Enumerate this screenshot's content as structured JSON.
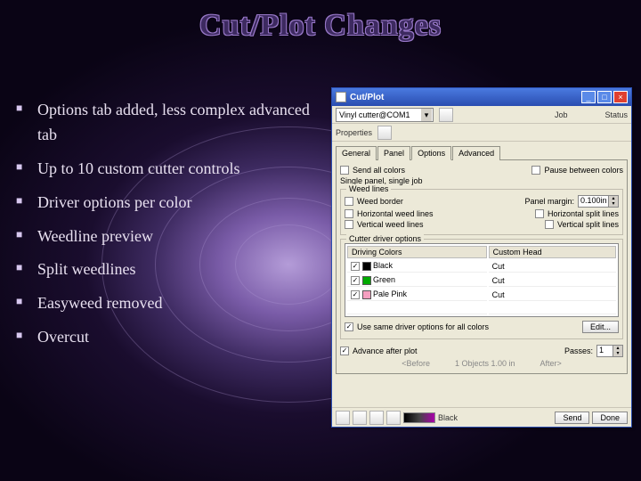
{
  "title": "Cut/Plot Changes",
  "bullets": [
    "Options tab added, less complex advanced tab",
    "Up to 10 custom cutter controls",
    "Driver options per color",
    "Weedline preview",
    "Split weedlines",
    "Easyweed removed",
    "Overcut"
  ],
  "win": {
    "title": "Cut/Plot",
    "btn_min": "_",
    "btn_max": "□",
    "btn_close": "×",
    "device": "Vinyl cutter@COM1",
    "props_label": "Properties",
    "job_label": "Job",
    "status_label": "Status",
    "tabs": [
      "General",
      "Panel",
      "Options",
      "Advanced"
    ],
    "active_tab": 2,
    "send_all": "Send all colors",
    "send_mode": "Single panel, single job",
    "pause_label": "Pause between colors",
    "weed_group": "Weed lines",
    "weed_border": "Weed border",
    "hweed": "Horizontal weed lines",
    "vweed": "Vertical weed lines",
    "hsplit": "Horizontal split lines",
    "vsplit": "Vertical split lines",
    "panel_margin_label": "Panel margin:",
    "panel_margin_value": "0.100in",
    "cutter_group": "Cutter driver options",
    "col_driving": "Driving Colors",
    "col_custom": "Custom Head",
    "rows": [
      {
        "color": "bk",
        "name": "Black",
        "head": "Cut"
      },
      {
        "color": "gr",
        "name": "Green",
        "head": "Cut"
      },
      {
        "color": "pk",
        "name": "Pale Pink",
        "head": "Cut"
      }
    ],
    "same_driver": "Use same driver options for all colors",
    "edit_btn": "Edit...",
    "advance_label": "Advance after plot",
    "passes_label": "Passes:",
    "passes_value": "1",
    "before_label": "<Before",
    "copies_info": "1 Objects 1.00 in",
    "after_label": "After>",
    "black_label": "Black",
    "send_btn": "Send",
    "done_btn": "Done"
  }
}
